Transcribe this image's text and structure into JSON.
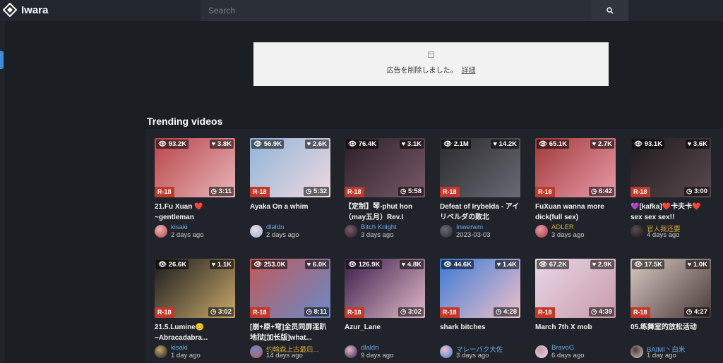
{
  "header": {
    "brand": "Iwara",
    "search_placeholder": "Search"
  },
  "ad": {
    "text": "広告を削除しました。",
    "link": "詳細"
  },
  "section_title": "Trending videos",
  "videos": [
    {
      "views": "93.2K",
      "likes": "3.8K",
      "rating": "R-18",
      "duration": "3:11",
      "title": "21.Fu Xuan ❤️ ~gentleman",
      "author": "kisaki",
      "date": "2 days ago",
      "author_color": "#6fa8e8",
      "thumb": [
        "#b8454a",
        "#e8b4b8"
      ]
    },
    {
      "views": "56.9K",
      "likes": "2.6K",
      "rating": "R-18",
      "duration": "5:32",
      "title": "Ayaka On a whim",
      "author": "dlaldn",
      "date": "2 days ago",
      "author_color": "#6fa8e8",
      "thumb": [
        "#8fb4d8",
        "#f0d8e0"
      ]
    },
    {
      "views": "76.4K",
      "likes": "3.1K",
      "rating": "R-18",
      "duration": "5:58",
      "title": "【定制】琴-phut hon（may五月）Rev.I",
      "author": "Bitch Knight",
      "date": "3 days ago",
      "author_color": "#6fa8e8",
      "thumb": [
        "#2a1e28",
        "#7a5a6a"
      ]
    },
    {
      "views": "2.1M",
      "likes": "14.2K",
      "rating": "R-18",
      "duration": "",
      "title": "Defeat of Irybelda - アイリベルダの敗北",
      "author": "Inwerwm",
      "date": "2023-03-03",
      "author_color": "#6fa8e8",
      "thumb": [
        "#2a2a30",
        "#6a6a72"
      ]
    },
    {
      "views": "65.1K",
      "likes": "2.7K",
      "rating": "R-18",
      "duration": "6:42",
      "title": "FuXuan wanna more dick(full sex)",
      "author": "ADLER",
      "date": "3 days ago",
      "author_color": "#d4a33a",
      "thumb": [
        "#a03a3a",
        "#e89aa8"
      ]
    },
    {
      "views": "93.1K",
      "likes": "3.6K",
      "rating": "R-18",
      "duration": "3:00",
      "title": "💜[kafka]❤️卡夫卡❤️sex sex sex!!",
      "author": "官人我还要",
      "date": "4 days ago",
      "author_color": "#d4a33a",
      "thumb": [
        "#1e1a1e",
        "#5a4a4e"
      ]
    },
    {
      "views": "26.6K",
      "likes": "1.1K",
      "rating": "R-18",
      "duration": "3:02",
      "title": "21.5.Lumine😊 ~Abracadabra...",
      "author": "kisaki",
      "date": "1 day ago",
      "author_color": "#6fa8e8",
      "thumb": [
        "#1a1a1e",
        "#c8a86a"
      ]
    },
    {
      "views": "253.0K",
      "likes": "6.0K",
      "rating": "R-18",
      "duration": "8:11",
      "title": "[崩+原+穹]全员同屏淫趴地狱[加长版]what...",
      "author": "约翰森上古最后...",
      "date": "14 days ago",
      "author_color": "#d4a33a",
      "thumb": [
        "#c05a5a",
        "#6a8ac8"
      ]
    },
    {
      "views": "126.9K",
      "likes": "4.8K",
      "rating": "R-18",
      "duration": "3:02",
      "title": "Azur_Lane",
      "author": "dlaldn",
      "date": "9 days ago",
      "author_color": "#6fa8e8",
      "thumb": [
        "#3a1e4a",
        "#e0b8c8"
      ]
    },
    {
      "views": "44.6K",
      "likes": "1.4K",
      "rating": "R-18",
      "duration": "4:28",
      "title": "shark bitches",
      "author": "マレーバク大佐",
      "date": "3 days ago",
      "author_color": "#6fa8e8",
      "thumb": [
        "#3a7ad8",
        "#f0c0c8"
      ]
    },
    {
      "views": "67.2K",
      "likes": "2.9K",
      "rating": "R-18",
      "duration": "4:39",
      "title": "March 7th X mob",
      "author": "BravoG",
      "date": "6 days ago",
      "author_color": "#6fa8e8",
      "thumb": [
        "#e8d8e8",
        "#c89aa8"
      ]
    },
    {
      "views": "17.5K",
      "likes": "1.0K",
      "rating": "R-18",
      "duration": "4:27",
      "title": "05.练舞室的放松活动",
      "author": "BAIMI丶白米",
      "date": "1 day ago",
      "author_color": "#6fa8e8",
      "thumb": [
        "#d8c8c0",
        "#4a3a3a"
      ]
    }
  ]
}
